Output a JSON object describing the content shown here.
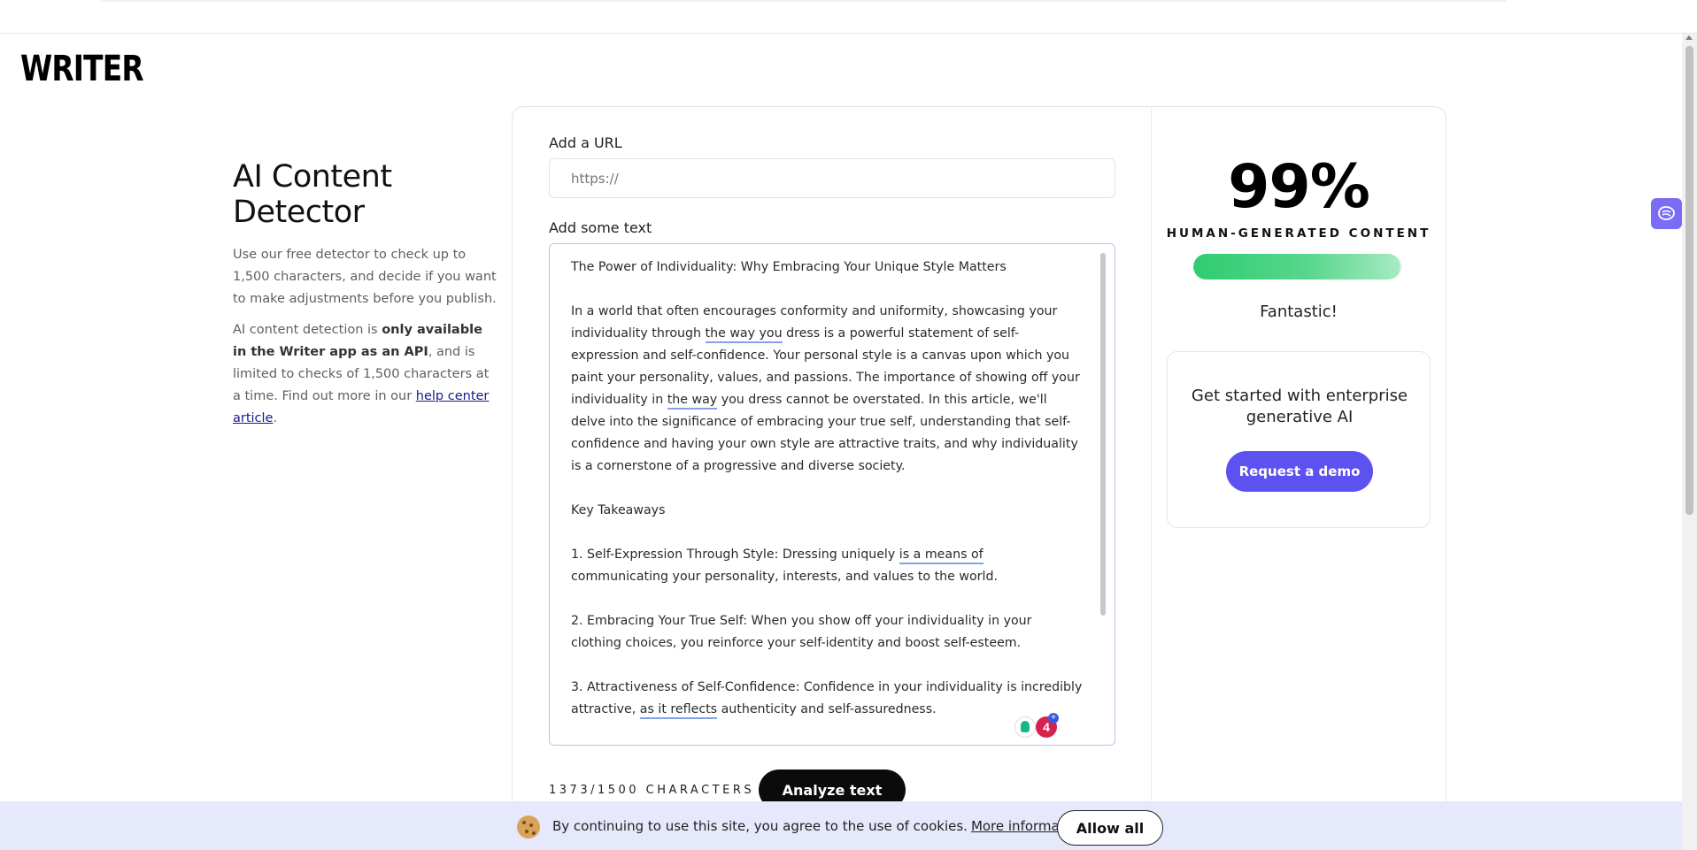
{
  "brand": {
    "logo_text": "WRITER"
  },
  "intro": {
    "title": "AI Content Detector",
    "description": "Use our free detector to check up to 1,500 characters, and decide if you want to make adjustments before you publish.",
    "api_note_prefix": "AI content detection is ",
    "api_note_bold": "only available in the Writer app as an API",
    "api_note_suffix": ", and is limited to checks of 1,500 characters at a time. Find out more in our ",
    "help_link": "help center article",
    "help_link_suffix": "."
  },
  "form": {
    "url_label": "Add a URL",
    "url_placeholder": "https://",
    "text_label": "Add some text",
    "text": {
      "title": "The Power of Individuality: Why Embracing Your Unique Style Matters",
      "p1_a": "In a world that often encourages conformity and uniformity, showcasing your individuality through ",
      "p1_u1": "the way you",
      "p1_b": " dress is a powerful statement of self-expression and self-confidence. Your personal style is a canvas upon which you paint your personality, values, and passions. The importance of showing off your individuality in ",
      "p1_u2": "the way",
      "p1_c": " you dress cannot be overstated. In this article, we'll delve into the significance of embracing your true self, understanding that self-confidence and having your own style are attractive traits, and why individuality is a cornerstone of a progressive and diverse society.",
      "key_takeaways": "Key Takeaways",
      "t1_a": "1. Self-Expression Through Style: Dressing uniquely ",
      "t1_u": "is a means of",
      "t1_b": " communicating your personality, interests, and values to the world.",
      "t2": "2. Embracing Your True Self: When you show off your individuality in your clothing choices, you reinforce your self-identity and boost self-esteem.",
      "t3_a": "3. Attractiveness of Self-Confidence: Confidence in your individuality is incredibly attractive, ",
      "t3_u": "as it reflects",
      "t3_b": " authenticity and self-assuredness."
    },
    "grammarly_count": "4",
    "char_count": "1373/1500 CHARACTERS",
    "analyze_label": "Analyze text"
  },
  "result": {
    "score": "99%",
    "score_label": "HUMAN-GENERATED CONTENT",
    "progress_percent": 99,
    "verdict": "Fantastic!"
  },
  "demo": {
    "title": "Get started with enterprise generative AI",
    "button_label": "Request a demo"
  },
  "cookie": {
    "text": "By continuing to use this site, you agree to the use of cookies.",
    "more_info": "More information",
    "allow_label": "Allow all"
  }
}
